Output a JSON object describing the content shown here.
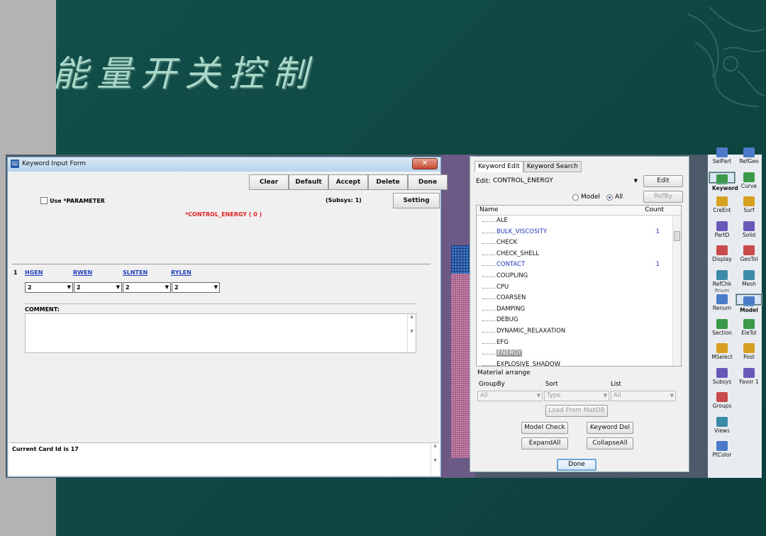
{
  "slide": {
    "title": "能量开关控制"
  },
  "keyword_input_form": {
    "title": "Keyword Input Form",
    "buttons": [
      "Clear",
      "Default",
      "Accept",
      "Delete",
      "Done"
    ],
    "setting_label": "Setting",
    "use_parameter_label": "Use *PARAMETER",
    "subsys_label": "(Subsys: 1)",
    "keyword_title": "*CONTROL_ENERGY  ( 0 )",
    "card_number": "1",
    "fields": [
      {
        "name": "HGEN",
        "value": "2"
      },
      {
        "name": "RWEN",
        "value": "2"
      },
      {
        "name": "SLNTEN",
        "value": "2"
      },
      {
        "name": "RYLEN",
        "value": "2"
      }
    ],
    "comment_label": "COMMENT:",
    "status_text": "Current Card Id is 17"
  },
  "keyword_panel": {
    "tabs": [
      "Keyword Edit",
      "Keyword Search"
    ],
    "edit_label": "Edit:",
    "edit_value": "CONTROL_ENERGY",
    "edit_button": "Edit",
    "refby_button": "RefBy",
    "radio_model": "Model",
    "radio_all": "All",
    "radio_selected": "All",
    "tree_header_name": "Name",
    "tree_header_count": "Count",
    "tree_items": [
      {
        "name": "ALE",
        "count": "",
        "highlight": false,
        "blue": false
      },
      {
        "name": "BULK_VISCOSITY",
        "count": "1",
        "highlight": false,
        "blue": true
      },
      {
        "name": "CHECK",
        "count": "",
        "highlight": false,
        "blue": false
      },
      {
        "name": "CHECK_SHELL",
        "count": "",
        "highlight": false,
        "blue": false
      },
      {
        "name": "CONTACT",
        "count": "1",
        "highlight": false,
        "blue": true
      },
      {
        "name": "COUPLING",
        "count": "",
        "highlight": false,
        "blue": false
      },
      {
        "name": "CPU",
        "count": "",
        "highlight": false,
        "blue": false
      },
      {
        "name": "COARSEN",
        "count": "",
        "highlight": false,
        "blue": false
      },
      {
        "name": "DAMPING",
        "count": "",
        "highlight": false,
        "blue": false
      },
      {
        "name": "DEBUG",
        "count": "",
        "highlight": false,
        "blue": false
      },
      {
        "name": "DYNAMIC_RELAXATION",
        "count": "",
        "highlight": false,
        "blue": false
      },
      {
        "name": "EFG",
        "count": "",
        "highlight": false,
        "blue": false
      },
      {
        "name": "ENERGY",
        "count": "",
        "highlight": true,
        "blue": false
      },
      {
        "name": "EXPLOSIVE_SHADOW",
        "count": "",
        "highlight": false,
        "blue": false
      }
    ],
    "material_arrange_label": "Material arrange",
    "groupby_label": "GroupBy",
    "sort_label": "Sort",
    "list_label": "List",
    "groupby_value": "All",
    "sort_value": "Type",
    "list_value": "All",
    "load_button": "Load From MatDB",
    "model_check_button": "Model Check",
    "keyword_del_button": "Keyword Del",
    "expand_all_button": "ExpandAll",
    "collapse_all_button": "CollapseAll",
    "done_button": "Done"
  },
  "toolbar": {
    "left": [
      "SelPart",
      "Keyword",
      "CreEnt",
      "PartD",
      "Display",
      "RefChk",
      "Renum",
      "Section",
      "MSelect",
      "Subsys",
      "Groups",
      "Views",
      "PtColor"
    ],
    "right": [
      "RefGeo",
      "Curve",
      "Surf",
      "Solid",
      "GeoTol",
      "Mesh",
      "Model",
      "EleTol",
      "Post",
      "Favor 1"
    ],
    "partial_label": "Rnum",
    "selected_left": "Keyword",
    "selected_right": "Model"
  }
}
